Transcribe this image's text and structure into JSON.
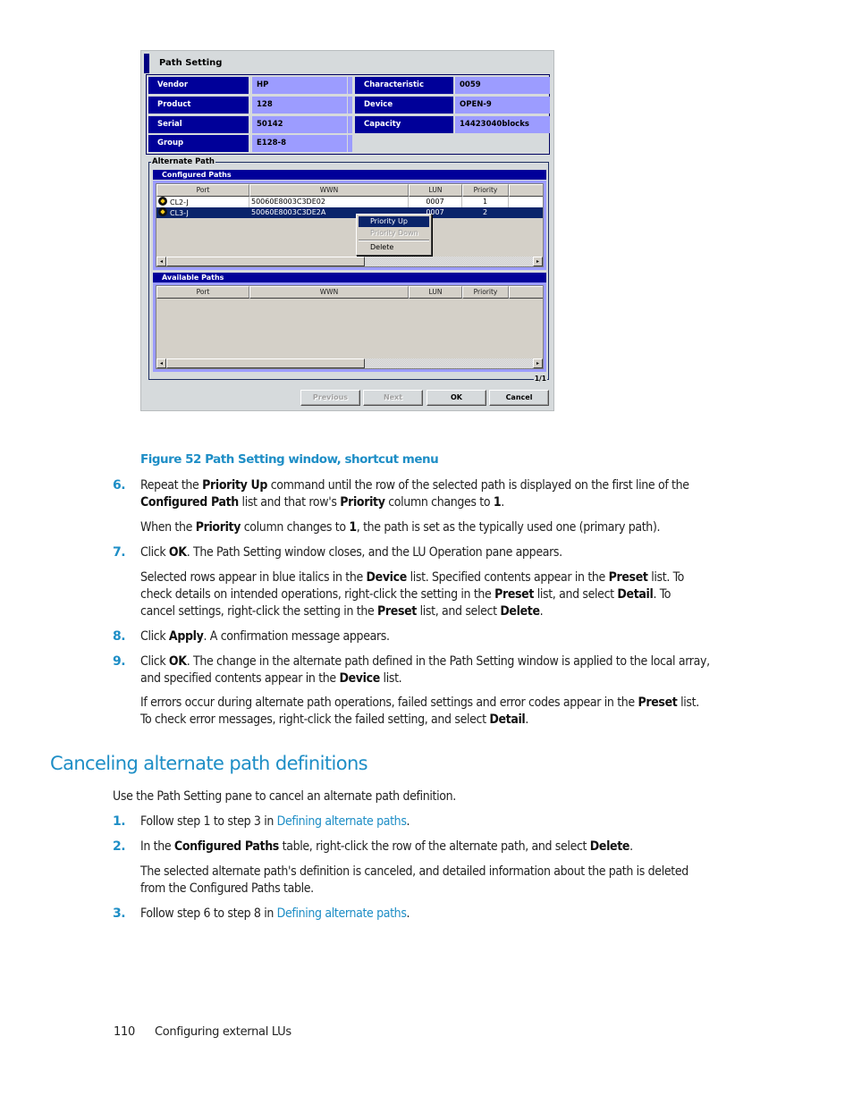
{
  "window": {
    "title": "Path Setting",
    "info_fields": [
      {
        "label": "Vendor",
        "value": "HP"
      },
      {
        "label": "Product",
        "value": "128"
      },
      {
        "label": "Serial",
        "value": "50142"
      },
      {
        "label": "Group",
        "value": "E128-8"
      },
      {
        "label": "Characteristic",
        "value": "0059"
      },
      {
        "label": "Device",
        "value": "OPEN-9"
      },
      {
        "label": "Capacity",
        "value": "14423040blocks"
      }
    ],
    "alternate_path_label": "Alternate Path",
    "configured_paths": {
      "title": "Configured Paths",
      "columns": [
        "Port",
        "WWN",
        "LUN",
        "Priority"
      ],
      "rows": [
        {
          "port": "CL2-J",
          "wwn": "50060E8003C3DE02",
          "lun": "0007",
          "priority": "1",
          "selected": false
        },
        {
          "port": "CL3-J",
          "wwn": "50060E8003C3DE2A",
          "lun": "0007",
          "priority": "2",
          "selected": true
        }
      ]
    },
    "context_menu": {
      "items": [
        {
          "label": "Priority Up",
          "state": "highlighted"
        },
        {
          "label": "Priority Down",
          "state": "disabled"
        },
        {
          "label": "Delete",
          "state": "enabled"
        }
      ]
    },
    "available_paths": {
      "title": "Available Paths",
      "columns": [
        "Port",
        "WWN",
        "LUN",
        "Priority"
      ],
      "rows": []
    },
    "page_indicator": "1/1",
    "buttons": {
      "previous": "Previous",
      "next": "Next",
      "ok": "OK",
      "cancel": "Cancel"
    },
    "scroll_left_glyph": "◂",
    "scroll_right_glyph": "▸"
  },
  "document": {
    "figure_caption": "Figure 52 Path Setting window, shortcut menu",
    "steps_a": [
      {
        "num": "6.",
        "html_parts": [
          "Repeat the ",
          "Priority Up",
          " command until the row of the selected path is displayed on the first line of the ",
          "Configured Path",
          " list and that row's ",
          "Priority",
          " column changes to ",
          "1",
          "."
        ]
      },
      {
        "num": "7.",
        "html_parts": [
          "Click ",
          "OK",
          ". The Path Setting window closes, and the LU Operation pane appears."
        ]
      },
      {
        "num": "8.",
        "html_parts": [
          "Click ",
          "Apply",
          ". A confirmation message appears."
        ]
      },
      {
        "num": "9.",
        "html_parts": [
          "Click ",
          "OK",
          ". The change in the alternate path defined in the Path Setting window is applied to the local array, and specified contents appear in the ",
          "Device",
          " list."
        ]
      }
    ],
    "note_6": [
      "When the ",
      "Priority",
      " column changes to ",
      "1",
      ", the path is set as the typically used one (primary path)."
    ],
    "note_7": [
      "Selected rows appear in blue italics in the ",
      "Device",
      " list. Specified contents appear in the ",
      "Preset",
      " list. To check details on intended operations, right-click the setting in the ",
      "Preset",
      " list, and select ",
      "Detail",
      ". To cancel settings, right-click the setting in the ",
      "Preset",
      " list, and select ",
      "Delete",
      "."
    ],
    "note_9": [
      "If errors occur during alternate path operations, failed settings and error codes appear in the ",
      "Preset",
      " list. To check error messages, right-click the failed setting, and select ",
      "Detail",
      "."
    ],
    "section_heading": "Canceling alternate path definitions",
    "section_intro": "Use the Path Setting pane to cancel an alternate path definition.",
    "steps_b": [
      {
        "num": "1.",
        "parts": [
          "Follow step 1 to step 3 in ",
          "Defining alternate paths",
          "."
        ]
      },
      {
        "num": "2.",
        "parts": [
          "In the ",
          "Configured Paths",
          " table, right-click the row of the alternate path, and select ",
          "Delete",
          "."
        ]
      },
      {
        "num": "3.",
        "parts": [
          "Follow step 6 to step 8 in ",
          "Defining alternate paths",
          "."
        ]
      }
    ],
    "note_b2": "The selected alternate path's definition is canceled, and detailed information about the path is deleted from the Configured Paths table.",
    "footer": {
      "page_number": "110",
      "chapter": "Configuring external LUs"
    }
  }
}
